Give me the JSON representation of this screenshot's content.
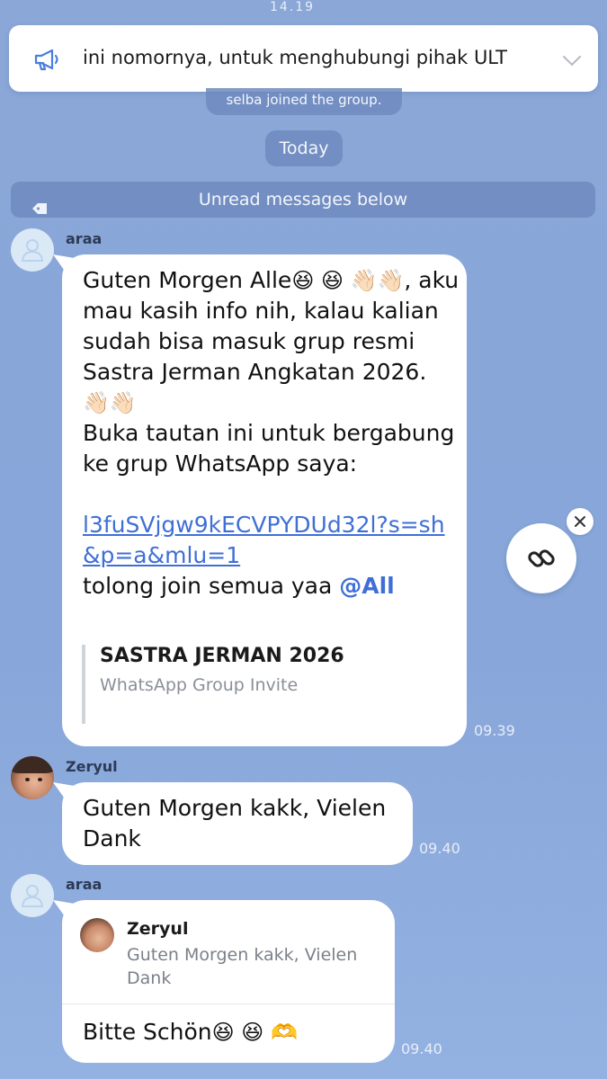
{
  "announcement": {
    "text": "ini nomornya, untuk menghubungi pihak ULT",
    "icon": "megaphone-icon"
  },
  "top_timestamp": "14.19",
  "system": {
    "joined": "selba joined the group.",
    "date_divider": "Today",
    "unread": "Unread messages below"
  },
  "messages": [
    {
      "sender": "araa",
      "lines": [
        "Guten Morgen Alle",
        ", aku mau kasih info nih, kalau kalian sudah bisa masuk grup resmi Sastra Jerman Angkatan 2026.",
        "Buka tautan ini untuk bergabung ke grup WhatsApp saya:"
      ],
      "emoji_a": "😆 😆 👋🏻👋🏻",
      "emoji_b": "👋🏻👋🏻",
      "link": "l3fuSVjgw9kECVPYDUd32l?s=sh&p=a&mlu=1",
      "tail_text": "tolong join semua yaa",
      "mention": "@All",
      "preview": {
        "title": "SASTRA JERMAN 2026",
        "subtitle": "WhatsApp Group Invite"
      },
      "time": "09.39"
    },
    {
      "sender": "Zeryul",
      "text": "Guten Morgen kakk, Vielen Dank",
      "time": "09.40"
    },
    {
      "sender": "araa",
      "reply_to": {
        "name": "Zeryul",
        "text": "Guten Morgen kakk, Vielen Dank"
      },
      "text": "Bitte Schön",
      "emoji": "😆 😆 🫶",
      "time": "09.40"
    }
  ],
  "colors": {
    "background": "#8aa7d8",
    "link": "#3f6fd6",
    "bubble": "#ffffff"
  }
}
